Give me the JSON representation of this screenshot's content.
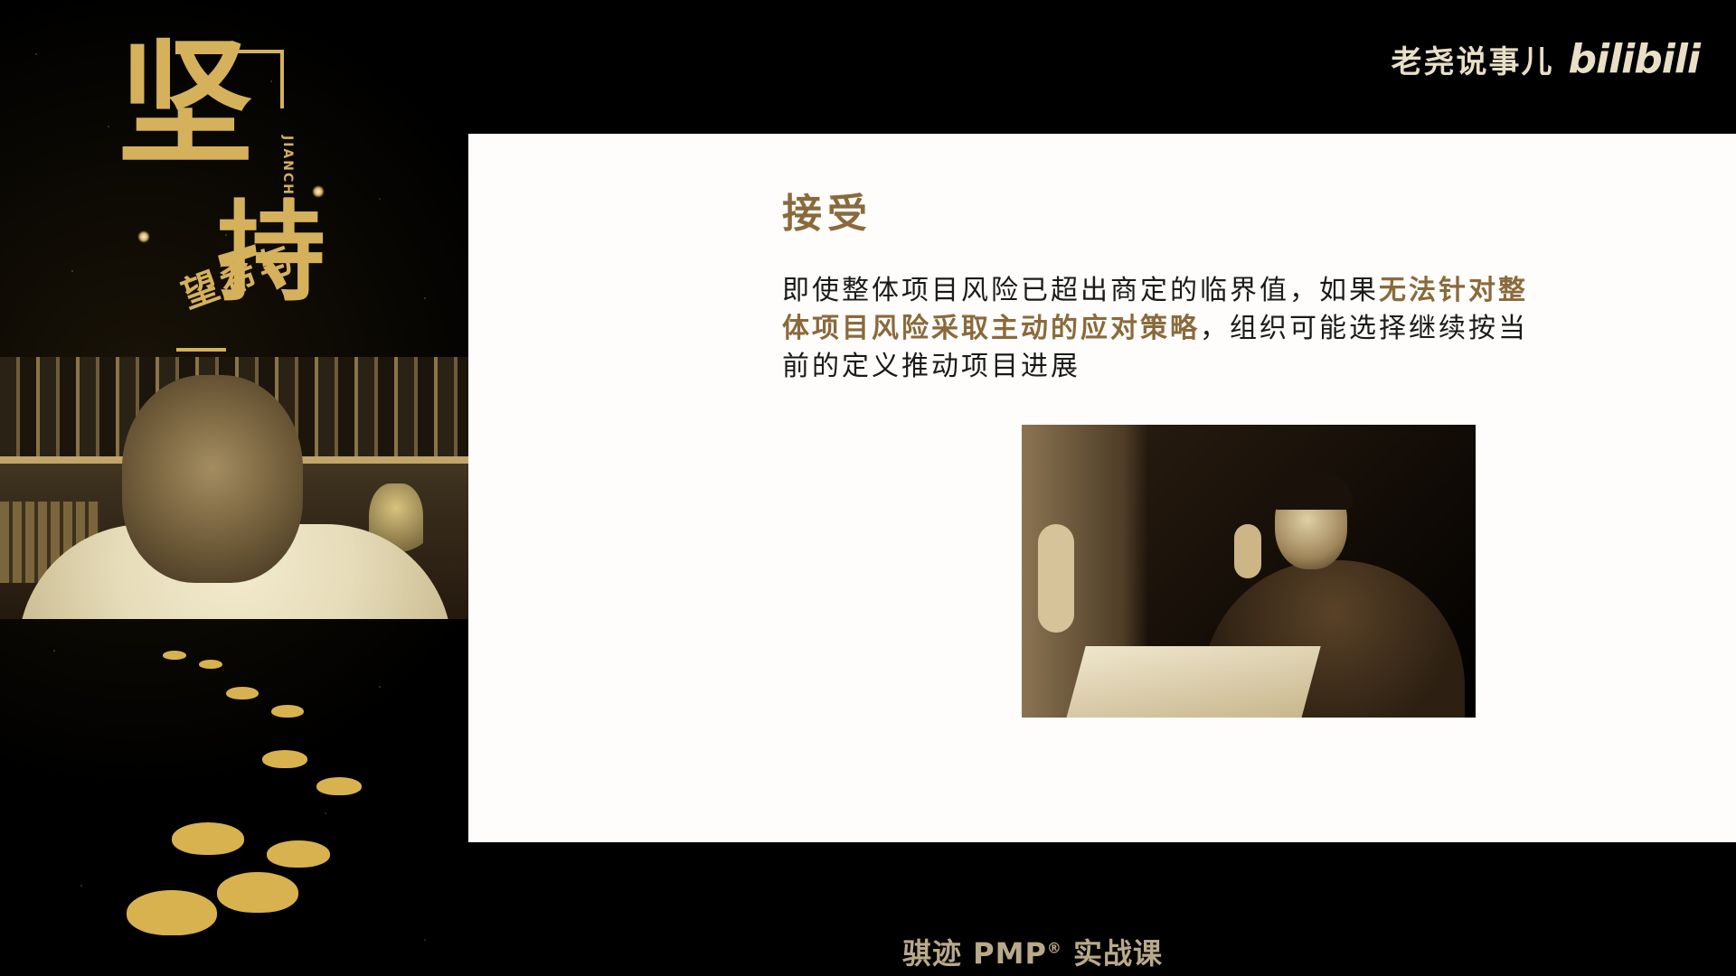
{
  "poster": {
    "title_char_1": "坚",
    "title_char_2": "持",
    "subtitle": "与希望",
    "pinyin": "JIANCHI"
  },
  "brand": {
    "name": "老尧说事儿",
    "logo_text": "bilibili",
    "color": "#e8dfc6"
  },
  "slide": {
    "title": "接受",
    "body_part1": "即使整体项目风险已超出商定的临界值，如果",
    "body_highlight": "无法针对整体项目风险采取主动的应对策略",
    "body_part2": "，组织可能选择继续按当前的定义推动项目进展",
    "accent_color": "#8a6a3c",
    "background_color": "#fefdfb"
  },
  "caption": {
    "prefix": "骐迹 PMP",
    "trademark": "®",
    "suffix": " 实战课"
  }
}
